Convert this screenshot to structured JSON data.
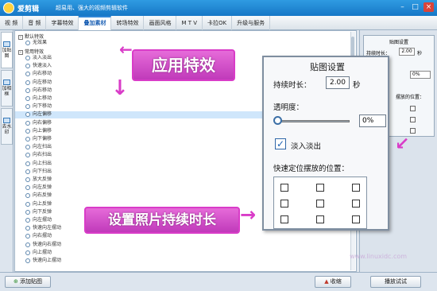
{
  "app": {
    "name": "爱剪辑",
    "slogan": "超易用、强大的视频剪辑软件",
    "win_min": "–",
    "win_max": "□",
    "win_close": "×"
  },
  "menu": [
    "视  频",
    "音  频",
    "字幕特效",
    "叠加素材",
    "转场特效",
    "画面风格",
    "M T V",
    "卡拉OK",
    "升级与服务"
  ],
  "left_tabs": [
    {
      "label": "加贴图"
    },
    {
      "label": "加相框"
    },
    {
      "label": "去水印"
    }
  ],
  "list": {
    "group1": "默认特效",
    "group1_items": [
      "无效果"
    ],
    "group2": "常用特效",
    "items": [
      "淡入淡出",
      "快速淡入",
      "向右移动",
      "向左移动",
      "向右移动",
      "向上移动",
      "向下移动",
      "向左偏移",
      "向右偏移",
      "向上偏移",
      "向下偏移",
      "向左扫出",
      "向右扫出",
      "向上扫出",
      "向下扫出",
      "放大反弹",
      "向左反弹",
      "向右反弹",
      "向上反弹",
      "向下反弹",
      "向左摆动",
      "快速向左摆动",
      "向右摆动",
      "快速向右摆动",
      "向上摆动",
      "快速向上摆动"
    ],
    "selected_index": 7
  },
  "right_small": {
    "title": "贴图设置",
    "dur_label": "持续时长：",
    "dur_value": "2.00",
    "dur_unit": "秒",
    "trans_value": "0%",
    "pos_label": "摆放的位置："
  },
  "panel": {
    "title": "贴图设置",
    "duration_label": "持续时长：",
    "duration_value": "2.00",
    "duration_unit": "秒",
    "transparency_label": "透明度：",
    "transparency_value": "0%",
    "transparency_fraction": 0,
    "fade_label": "淡入淡出",
    "fade_checked": true,
    "position_label": "快速定位摆放的位置："
  },
  "callouts": {
    "apply": "应用特效",
    "duration": "设置照片持续时长"
  },
  "buttons": {
    "add": "添加贴图",
    "collapse": "收缩",
    "preview": "播放试试"
  },
  "watermark": "www.linuxidc.com"
}
